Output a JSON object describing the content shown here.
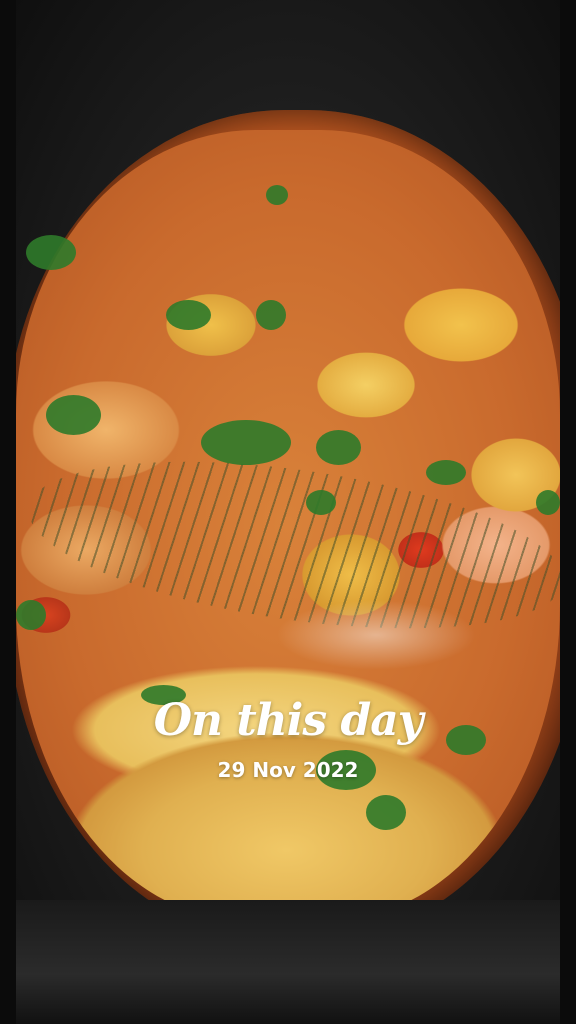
{
  "memory": {
    "title": "On this day",
    "date": "29 Nov 2022"
  },
  "photo": {
    "subject": "stew-in-pot"
  }
}
